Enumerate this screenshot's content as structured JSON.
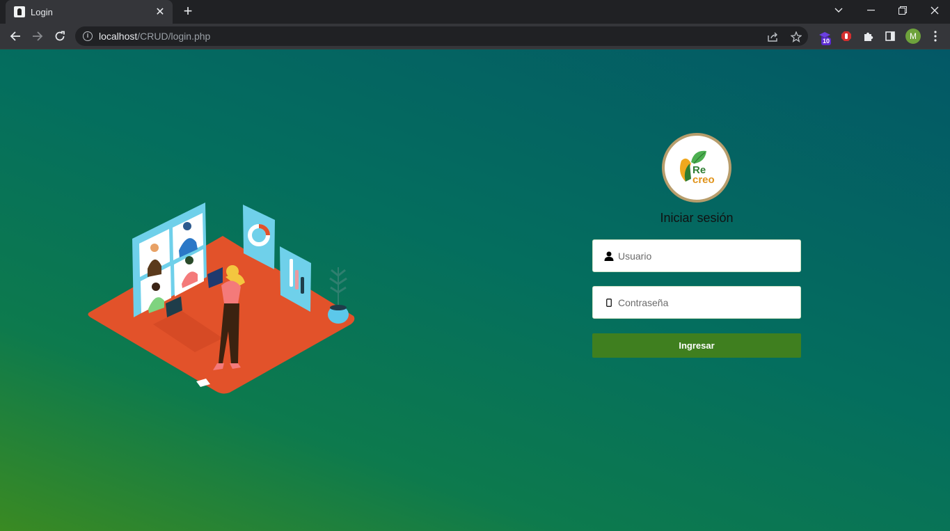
{
  "browser": {
    "tab_title": "Login",
    "tab_close": "✕",
    "new_tab": "+",
    "url_host": "localhost",
    "url_path": "/CRUD/login.php",
    "extension_badge": "10",
    "profile_initial": "M",
    "icons": [
      "back-arrow",
      "forward-arrow",
      "reload",
      "info",
      "share",
      "star",
      "extension-puzzle",
      "side-panel",
      "menu-kebab"
    ]
  },
  "login": {
    "logo_text_top": "Re",
    "logo_text_bottom": "creo",
    "title": "Iniciar sesión",
    "username_placeholder": "Usuario",
    "password_placeholder": "Contraseña",
    "submit_label": "Ingresar"
  },
  "colors": {
    "accent_button": "#3f7f1f",
    "logo_border": "#b79d6c",
    "platform": "#e2522a",
    "screen_panels": "#6fd0ea"
  }
}
